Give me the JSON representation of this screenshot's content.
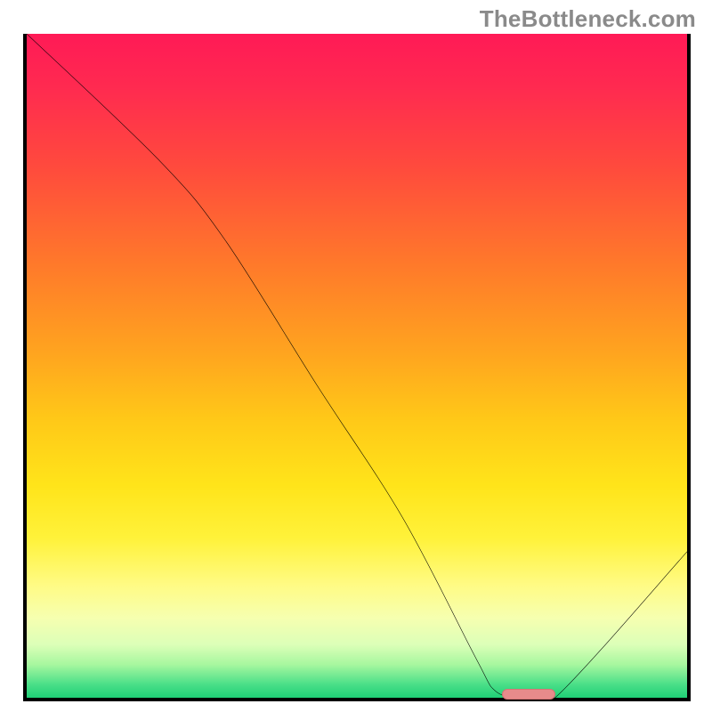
{
  "watermark": "TheBottleneck.com",
  "chart_data": {
    "type": "line",
    "title": "",
    "xlabel": "",
    "ylabel": "",
    "xlim": [
      0,
      100
    ],
    "ylim": [
      0,
      100
    ],
    "series": [
      {
        "name": "bottleneck-curve",
        "x": [
          0,
          20,
          30,
          44,
          57,
          68,
          71,
          75,
          80,
          100
        ],
        "y": [
          100,
          81,
          69,
          47,
          27,
          6,
          1,
          0,
          0,
          22
        ]
      }
    ],
    "optimal_range_x": [
      72,
      80
    ],
    "gradient_stops": [
      {
        "pct": 0,
        "color": "#ff1a56"
      },
      {
        "pct": 35,
        "color": "#ff7a2a"
      },
      {
        "pct": 68,
        "color": "#ffe41a"
      },
      {
        "pct": 88,
        "color": "#f6ffb0"
      },
      {
        "pct": 100,
        "color": "#1fcf76"
      }
    ]
  }
}
